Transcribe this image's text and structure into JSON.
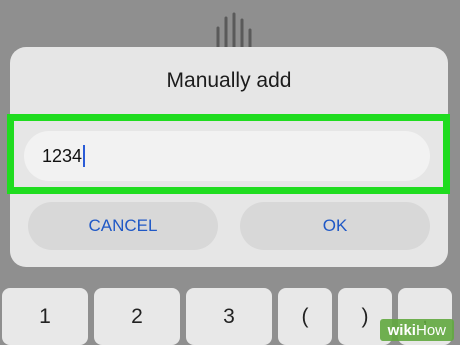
{
  "dialog": {
    "title": "Manually add",
    "input_value": "1234",
    "cancel_label": "CANCEL",
    "ok_label": "OK"
  },
  "keyboard": {
    "keys": [
      "1",
      "2",
      "3",
      "(",
      ")",
      ","
    ]
  },
  "watermark": {
    "brand": "wiki",
    "suffix": "How"
  },
  "colors": {
    "highlight": "#1fdc1f",
    "button_text": "#1f58c6",
    "dialog_bg": "#e6e6e6",
    "overlay_bg": "#8f8f8f"
  },
  "icons": {
    "background": "hand-icon"
  }
}
